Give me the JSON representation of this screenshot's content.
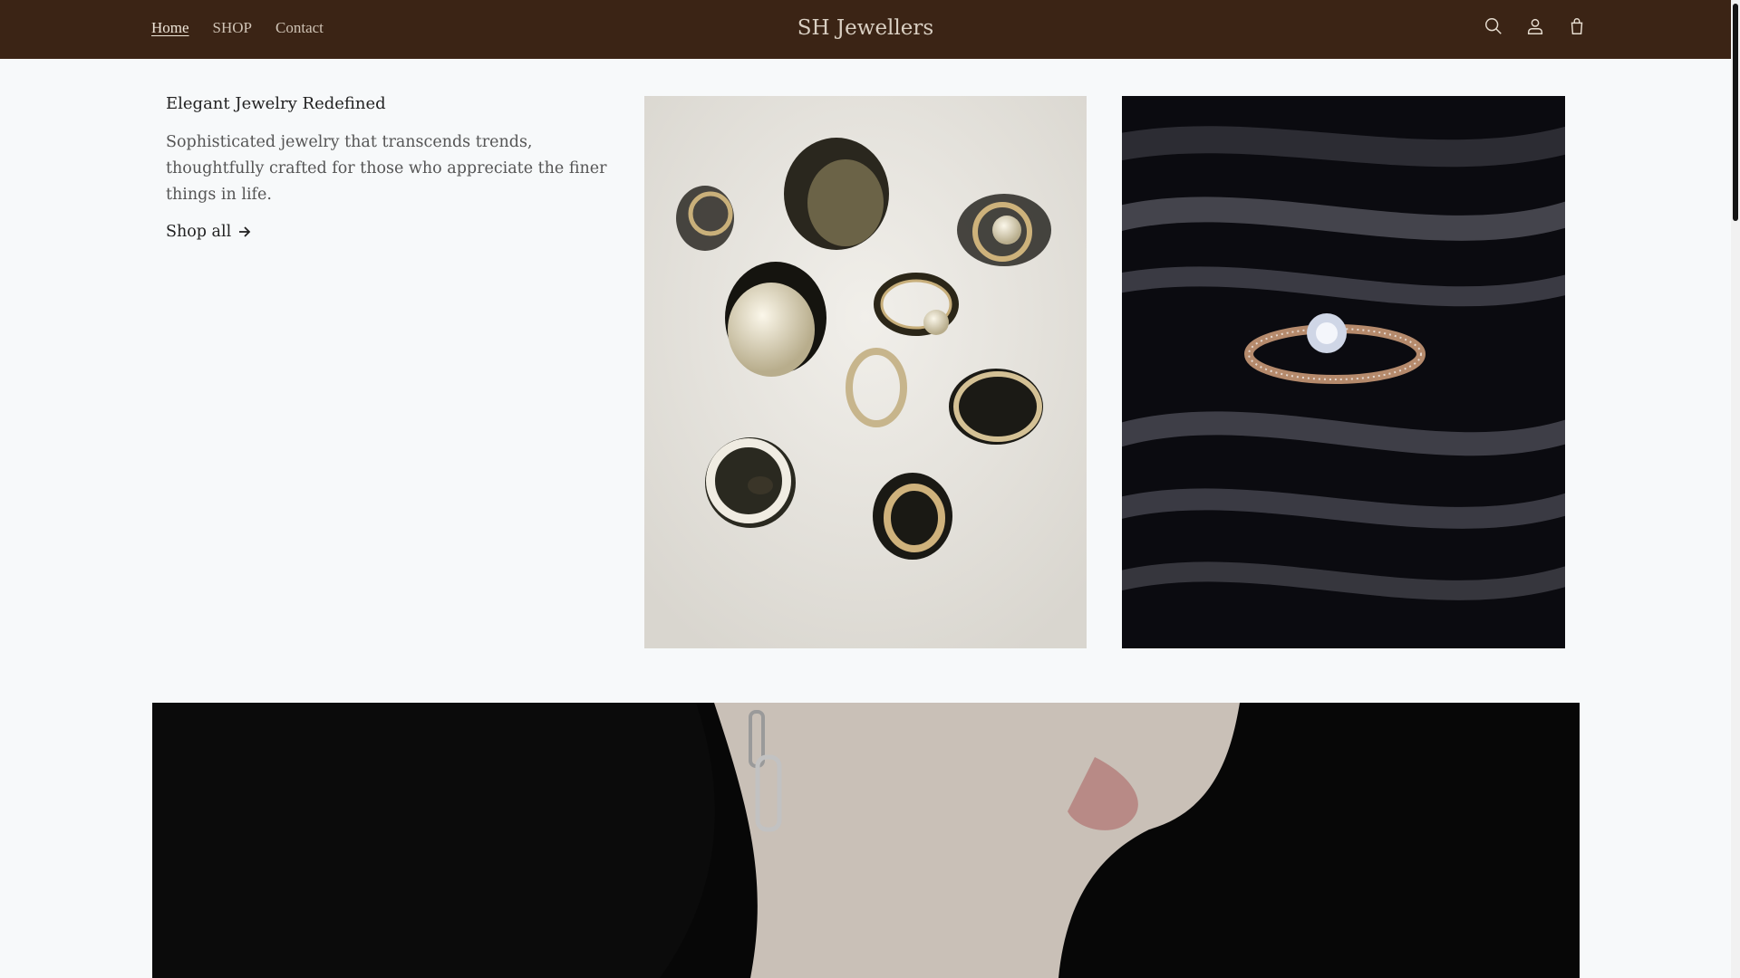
{
  "header": {
    "nav": [
      "Home",
      "SHOP",
      "Contact"
    ],
    "brand": "SH Jewellers",
    "icons": [
      "search-icon",
      "account-icon",
      "cart-icon"
    ],
    "background": "#3b2415"
  },
  "hero": {
    "title": "Elegant Jewelry Redefined",
    "description": "Sophisticated jewelry that transcends trends, thoughtfully crafted for those who appreciate the finer things in life.",
    "cta": "Shop all"
  }
}
